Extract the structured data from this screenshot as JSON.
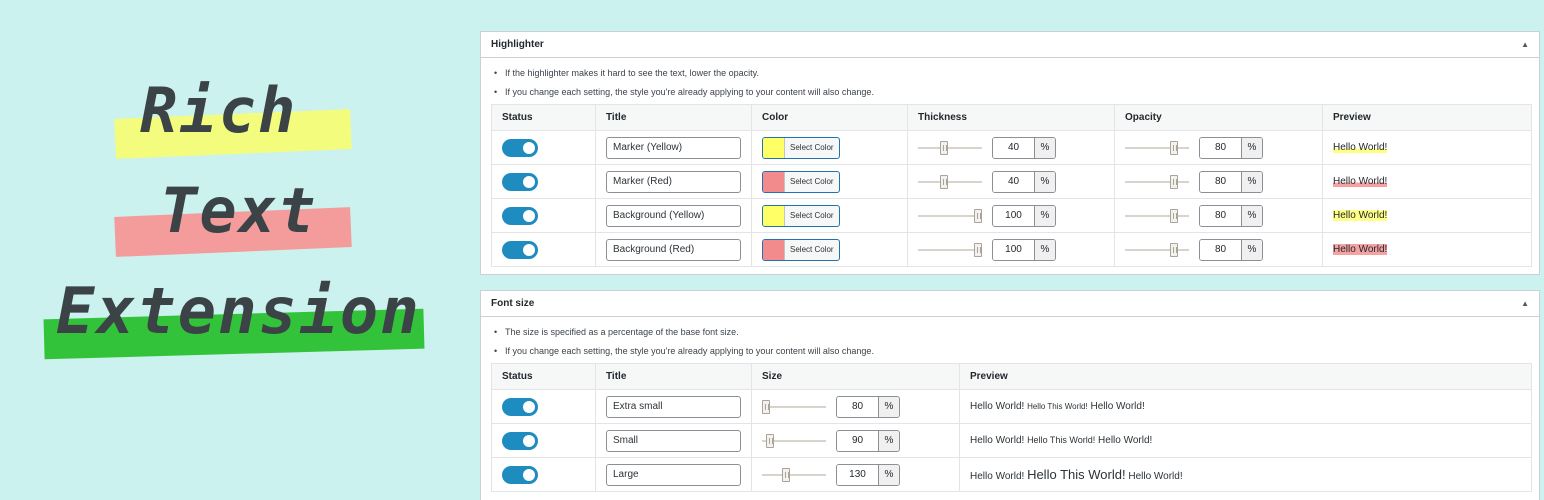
{
  "banner": {
    "line1": "Rich",
    "line2": "Text",
    "line3": "Extension"
  },
  "highlighter": {
    "title": "Highlighter",
    "collapse_icon": "▲",
    "notes": [
      "If the highlighter makes it hard to see the text, lower the opacity.",
      "If you change each setting, the style you're already applying to your content will also change."
    ],
    "headers": {
      "status": "Status",
      "title": "Title",
      "color": "Color",
      "thickness": "Thickness",
      "opacity": "Opacity",
      "preview": "Preview"
    },
    "select_color_label": "Select Color",
    "unit": "%",
    "rows": [
      {
        "enabled": true,
        "title": "Marker (Yellow)",
        "color": "#ffff66",
        "thickness": "40",
        "thickness_level": 0.4,
        "opacity": "80",
        "opacity_level": 0.8,
        "preview": "Hello World!",
        "style": "marker"
      },
      {
        "enabled": true,
        "title": "Marker (Red)",
        "color": "#f28b8b",
        "thickness": "40",
        "thickness_level": 0.4,
        "opacity": "80",
        "opacity_level": 0.8,
        "preview": "Hello World!",
        "style": "marker"
      },
      {
        "enabled": true,
        "title": "Background (Yellow)",
        "color": "#ffff66",
        "thickness": "100",
        "thickness_level": 1.0,
        "opacity": "80",
        "opacity_level": 0.8,
        "preview": "Hello World!",
        "style": "background"
      },
      {
        "enabled": true,
        "title": "Background (Red)",
        "color": "#f28b8b",
        "thickness": "100",
        "thickness_level": 1.0,
        "opacity": "80",
        "opacity_level": 0.8,
        "preview": "Hello World!",
        "style": "background"
      }
    ]
  },
  "font_size": {
    "title": "Font size",
    "collapse_icon": "▲",
    "notes": [
      "The size is specified as a percentage of the base font size.",
      "If you change each setting, the style you're already applying to your content will also change."
    ],
    "headers": {
      "status": "Status",
      "title": "Title",
      "size": "Size",
      "preview": "Preview"
    },
    "unit": "%",
    "rows": [
      {
        "enabled": true,
        "title": "Extra small",
        "size": "80",
        "size_level": 0.0,
        "preview_before": "Hello World!",
        "preview_sample": "Hello This World!",
        "preview_after": "Hello World!"
      },
      {
        "enabled": true,
        "title": "Small",
        "size": "90",
        "size_level": 0.08,
        "preview_before": "Hello World!",
        "preview_sample": "Hello This World!",
        "preview_after": "Hello World!"
      },
      {
        "enabled": true,
        "title": "Large",
        "size": "130",
        "size_level": 0.35,
        "preview_before": "Hello World!",
        "preview_sample": "Hello This World!",
        "preview_after": "Hello World!"
      }
    ]
  }
}
